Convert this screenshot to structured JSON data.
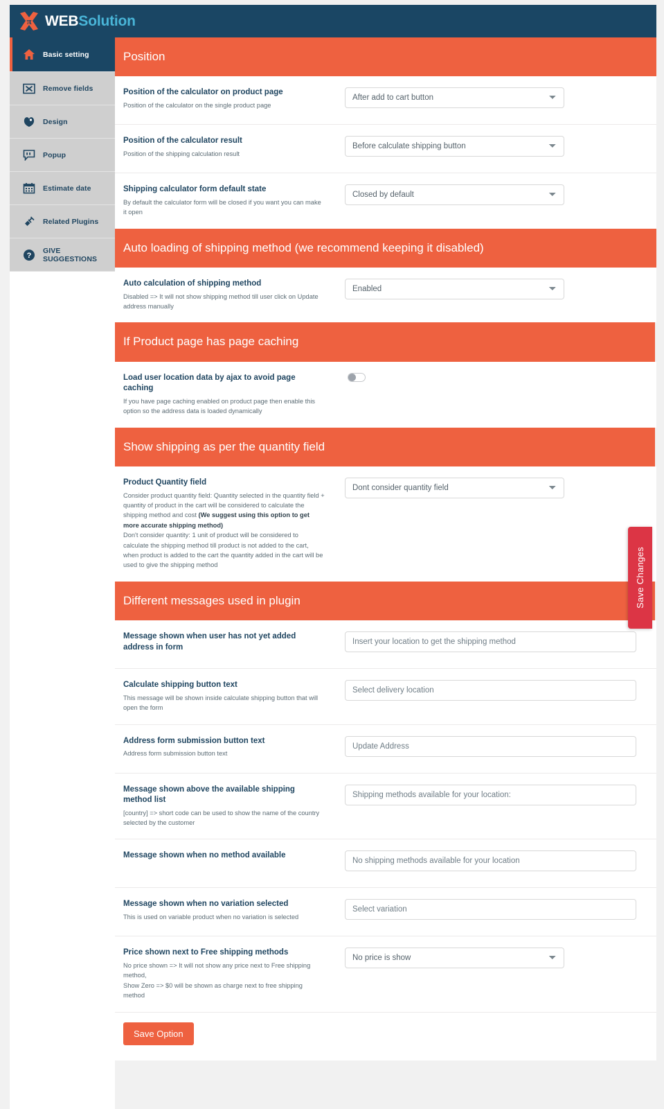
{
  "brand": {
    "name_bold": "WEB",
    "name_light": "Solution",
    "mark_icon": "pi-x-logo-icon",
    "navy": "#1a4664",
    "orange": "#ee6140",
    "accent_blue": "#49b5d8",
    "save_red": "#dc3545"
  },
  "sidebar": {
    "items": [
      {
        "label": "Basic setting",
        "icon": "home-icon",
        "active": true
      },
      {
        "label": "Remove fields",
        "icon": "remove-field-icon",
        "active": false
      },
      {
        "label": "Design",
        "icon": "design-icon",
        "active": false
      },
      {
        "label": "Popup",
        "icon": "popup-icon",
        "active": false
      },
      {
        "label": "Estimate date",
        "icon": "calendar-icon",
        "active": false
      },
      {
        "label": "Related Plugins",
        "icon": "plug-icon",
        "active": false
      },
      {
        "label": "GIVE SUGGESTIONS",
        "icon": "question-icon",
        "active": false
      }
    ]
  },
  "sections": {
    "position": {
      "title": "Position",
      "rows": [
        {
          "label": "Position of the calculator on product page",
          "desc": "Position of the calculator on the single product page",
          "value": "After add to cart button"
        },
        {
          "label": "Position of the calculator result",
          "desc": "Position of the shipping calculation result",
          "value": "Before calculate shipping button"
        },
        {
          "label": "Shipping calculator form default state",
          "desc": "By default the calculator form will be closed if you want you can make it open",
          "value": "Closed by default"
        }
      ]
    },
    "auto_loading": {
      "title": "Auto loading of shipping method (we recommend keeping it disabled)",
      "rows": [
        {
          "label": "Auto calculation of shipping method",
          "desc": "Disabled => It will not show shipping method till user click on Update address manually",
          "value": "Enabled"
        }
      ]
    },
    "page_caching": {
      "title": "If Product page has page caching",
      "rows": [
        {
          "label": "Load user location data by ajax to avoid page caching",
          "desc": "If you have page caching enabled on product page then enable this option so the address data is loaded dynamically",
          "toggle_on": false
        }
      ]
    },
    "quantity": {
      "title": "Show shipping as per the quantity field",
      "rows": [
        {
          "label": "Product Quantity field",
          "desc_part1": "Consider product quantity field: Quantity selected in the quantity field + quantity of product in the cart will be considered to calculate the shipping method and cost ",
          "desc_bold": "(We suggest using this option to get more accurate shipping method)",
          "desc_part2": "Don't consider quantity: 1 unit of product will be considered to calculate the shipping method till product is not added to the cart, when product is added to the cart the quantity added in the cart will be used to give the shipping method",
          "value": "Dont consider quantity field"
        }
      ]
    },
    "messages": {
      "title": "Different messages used in plugin",
      "rows": [
        {
          "label": "Message shown when user has not yet added address in form",
          "desc": "",
          "value": "Insert your location to get the shipping method"
        },
        {
          "label": "Calculate shipping button text",
          "desc": "This message will be shown inside calculate shipping button that will open the form",
          "value": "Select delivery location"
        },
        {
          "label": "Address form submission button text",
          "desc": "Address form submission button text",
          "value": "Update Address"
        },
        {
          "label": "Message shown above the available shipping method list",
          "desc": "[country] => short code can be used to show the name of the country selected by the customer",
          "value": "Shipping methods available for your location:"
        },
        {
          "label": "Message shown when no method available",
          "desc": "",
          "value": "No shipping methods available for your location"
        },
        {
          "label": "Message shown when no variation selected",
          "desc": "This is used on variable product when no variation is selected",
          "value": "Select variation"
        }
      ],
      "price_row": {
        "label": "Price shown next to Free shipping methods",
        "desc_line1": "No price shown => It will not show any price next to Free shipping method,",
        "desc_line2": "Show Zero => $0 will be shown as charge next to free shipping method",
        "value": "No price is show"
      }
    }
  },
  "buttons": {
    "save_option": "Save Option",
    "save_changes": "Save Changes"
  }
}
